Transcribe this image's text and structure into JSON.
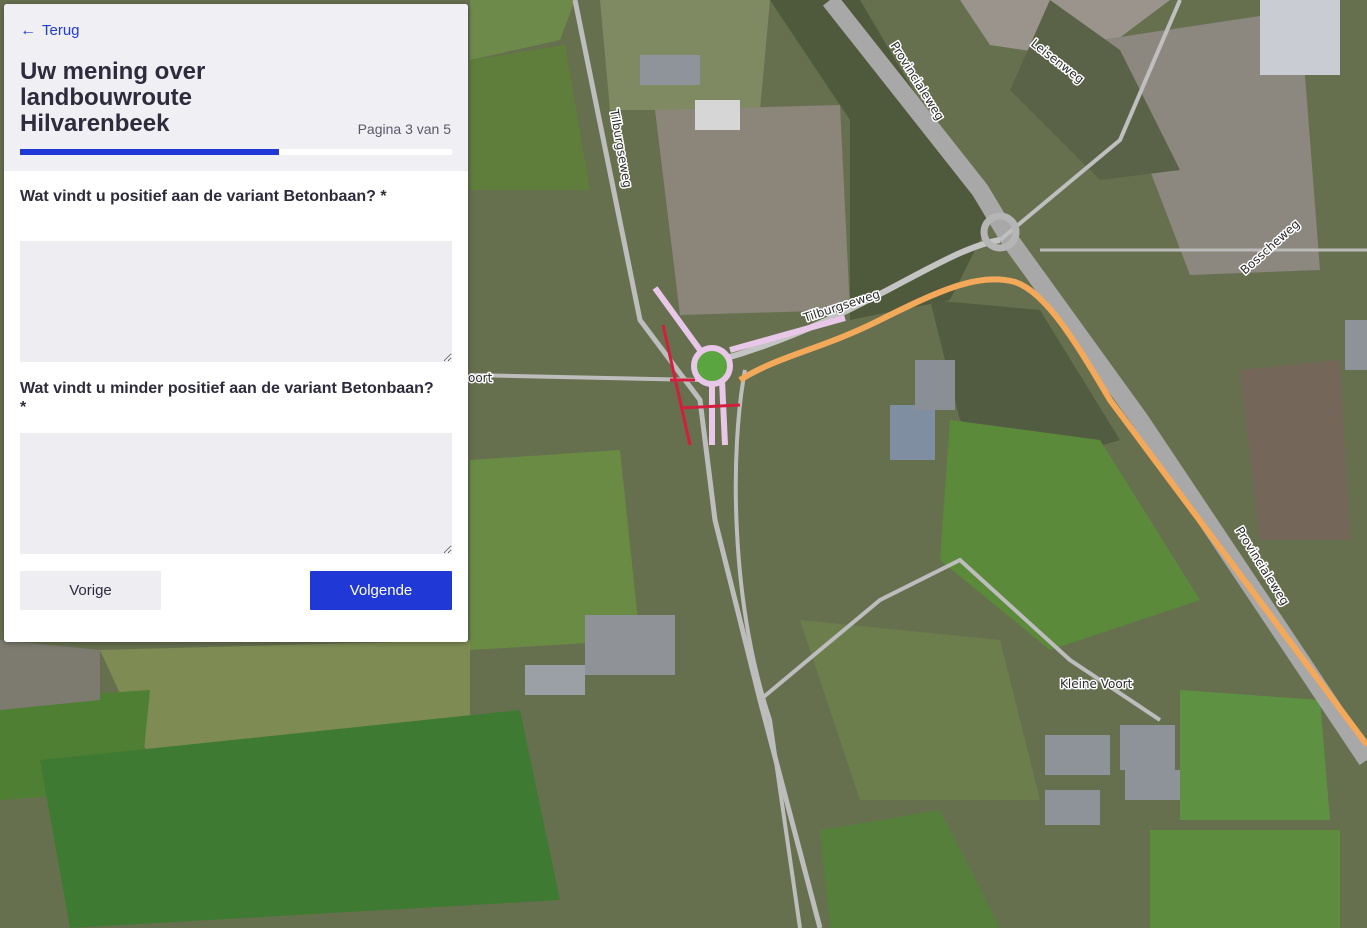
{
  "map": {
    "street_labels": [
      "Tilburgseweg",
      "Provincialeweg",
      "Leisenweg",
      "Tilburgseweg",
      "Bosscheweg",
      "Provincialeweg",
      "Kleine Voort",
      "oort"
    ]
  },
  "panel": {
    "back_label": "Terug",
    "back_icon": "arrow-left-icon",
    "title": "Uw mening over landbouwroute Hilvarenbeek",
    "page_indicator": "Pagina 3 van 5",
    "progress": 0.6,
    "progress_color": "#2038d6"
  },
  "questions": [
    {
      "label": "Wat vindt u positief aan de variant Betonbaan? *",
      "value": ""
    },
    {
      "label": "Wat vindt u minder positief aan de variant Betonbaan? *",
      "value": ""
    }
  ],
  "buttons": {
    "prev_label": "Vorige",
    "next_label": "Volgende"
  }
}
